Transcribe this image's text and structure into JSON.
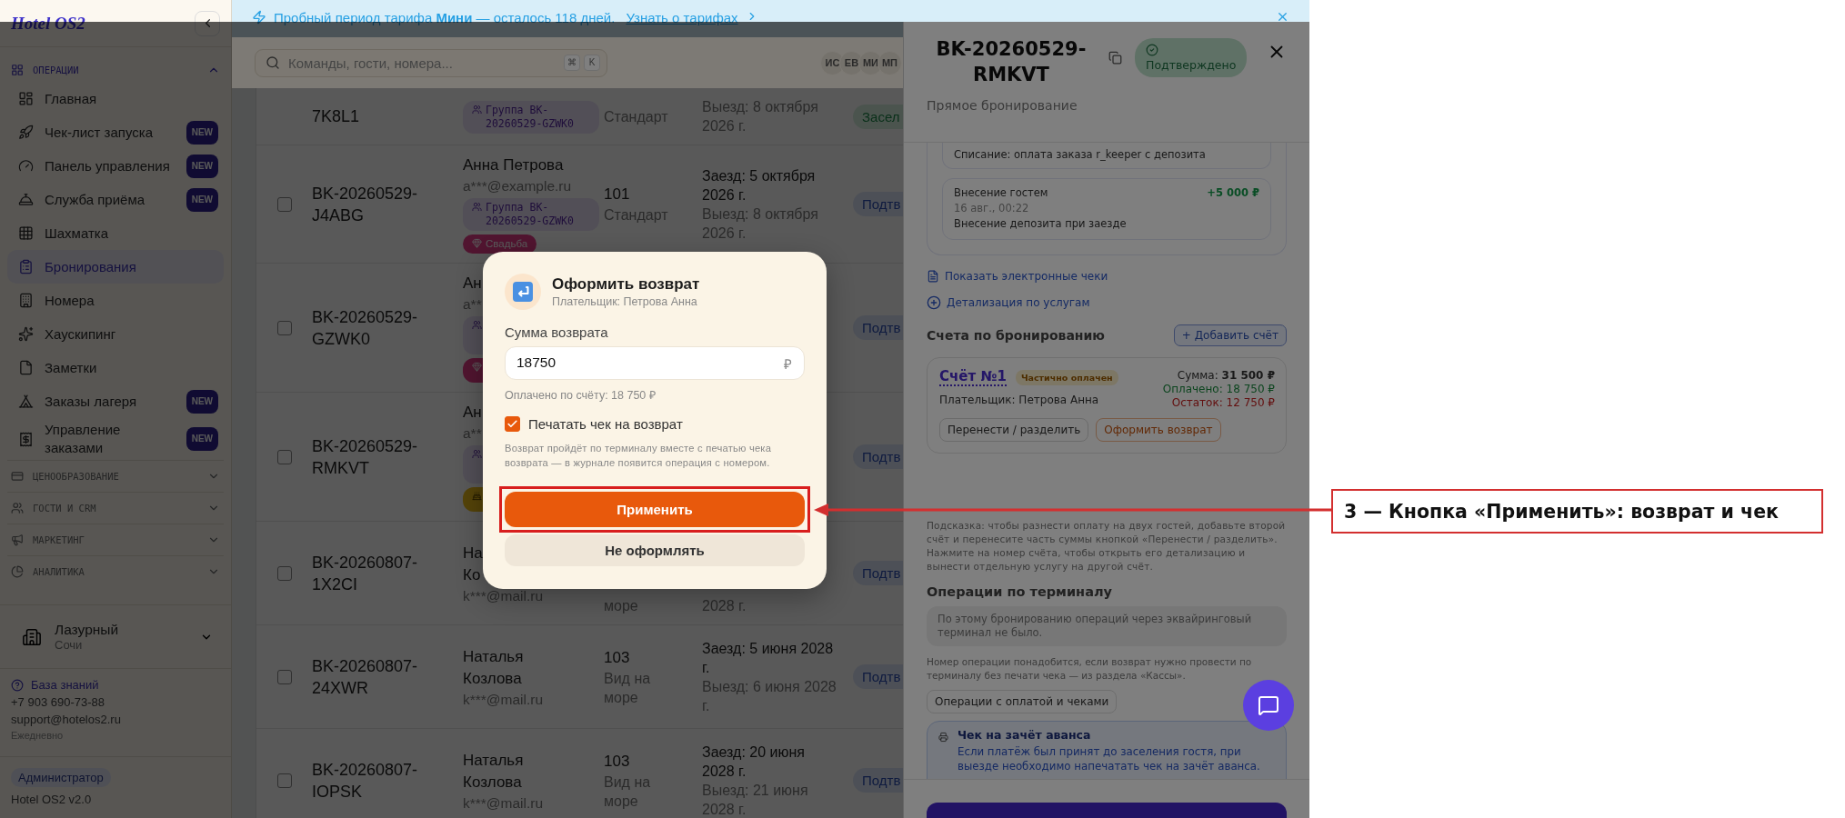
{
  "banner": {
    "text": "Пробный период тарифа **Мини** — осталось 118 дней.",
    "link": "Узнать о тарифах"
  },
  "sidebar": {
    "logo": "Hotel OS2",
    "sections": [
      {
        "title": "ОПЕРАЦИИ",
        "expanded": true,
        "items": [
          {
            "label": "Главная",
            "selected": false
          },
          {
            "label": "Чек-лист запуска",
            "badge": "NEW",
            "selected": false
          },
          {
            "label": "Панель управления",
            "badge": "NEW",
            "selected": false
          },
          {
            "label": "Служба приёма",
            "badge": "NEW",
            "selected": false
          },
          {
            "label": "Шахматка",
            "selected": false
          },
          {
            "label": "Бронирования",
            "selected": true
          },
          {
            "label": "Номера",
            "selected": false
          },
          {
            "label": "Хаускипинг",
            "selected": false
          },
          {
            "label": "Заметки",
            "selected": false
          },
          {
            "label": "Заказы лагеря",
            "badge": "NEW",
            "selected": false
          },
          {
            "label": "Управление заказами",
            "badge": "NEW",
            "selected": false
          }
        ]
      },
      {
        "title": "ЦЕНООБРАЗОВАНИЕ",
        "expanded": false
      },
      {
        "title": "ГОСТИ И CRM",
        "expanded": false
      },
      {
        "title": "МАРКЕТИНГ",
        "expanded": false
      },
      {
        "title": "АНАЛИТИКА",
        "expanded": false
      }
    ],
    "hotel": {
      "name": "Лазурный",
      "city": "Сочи"
    },
    "support": {
      "link": "База знаний",
      "phone": "+7 903 690-73-88",
      "email": "support@hotelos2.ru",
      "hours": "Ежедневно"
    },
    "role": "Администратор",
    "version": "Hotel OS2 v2.0"
  },
  "topbar": {
    "search_placeholder": "Команды, гости, номера...",
    "shortcut": [
      "⌘",
      "K"
    ],
    "avatars": [
      "ИС",
      "ЕВ",
      "МИ",
      "МП"
    ]
  },
  "bookings": [
    {
      "id": "7K8L1",
      "guest": {
        "tags": [
          {
            "kind": "group",
            "label": "Группа BK-20260529-GZWK0"
          }
        ]
      },
      "room": {
        "type": "Стандарт"
      },
      "dates": {
        "checkout": "Выезд: 8 октября 2026 г."
      },
      "status": {
        "kind": "checked_in",
        "label": "Засел"
      }
    },
    {
      "id": "BK-20260529-J4ABG",
      "checked": false,
      "guest": {
        "name": "Анна Петрова",
        "email": "a***@example.ru",
        "tags": [
          {
            "kind": "group",
            "label": "Группа BK-20260529-GZWK0"
          },
          {
            "kind": "wedding",
            "label": "Свадьба"
          }
        ]
      },
      "room": {
        "number": "101",
        "type": "Стандарт"
      },
      "dates": {
        "checkin": "Заезд: 5 октября 2026 г.",
        "checkout": "Выезд: 8 октября 2026 г."
      },
      "status": {
        "kind": "confirmed",
        "label": "Подтв"
      }
    },
    {
      "id": "BK-20260529-GZWK0",
      "checked": false,
      "guest": {
        "name": "Ан",
        "email": "a**",
        "tags": [
          {
            "kind": "group"
          },
          {
            "kind": "wedding"
          }
        ]
      },
      "status": {
        "kind": "confirmed",
        "label": "Подтв"
      }
    },
    {
      "id": "BK-20260529-RMKVT",
      "checked": false,
      "guest": {
        "name": "Ан",
        "email": "a**",
        "tags": [
          {
            "kind": "group"
          },
          {
            "kind": "birthday"
          }
        ]
      },
      "status": {
        "kind": "confirmed",
        "label": "Подтв"
      }
    },
    {
      "id": "BK-20260807-1X2CI",
      "checked": false,
      "covered": true,
      "guest": {
        "name": "На\nКо",
        "email": "k***@mail.ru"
      },
      "room": {
        "type": "море"
      },
      "dates": {
        "checkout": "2028 г."
      },
      "status": {
        "kind": "confirmed",
        "label": "Подтв"
      }
    },
    {
      "id": "BK-20260807-24XWR",
      "checked": false,
      "guest": {
        "name": "Наталья Козлова",
        "email": "k***@mail.ru"
      },
      "room": {
        "number": "103",
        "type": "Вид на море"
      },
      "dates": {
        "checkin": "Заезд: 5 июня 2028 г.",
        "checkout": "Выезд: 6 июня 2028 г."
      },
      "status": {
        "kind": "confirmed",
        "label": "Подтв"
      }
    },
    {
      "id": "BK-20260807-IOPSK",
      "checked": false,
      "guest": {
        "name": "Наталья Козлова",
        "email": "k***@mail.ru"
      },
      "room": {
        "number": "103",
        "type": "Вид на море"
      },
      "dates": {
        "checkin": "Заезд: 20 июня 2028 г.",
        "checkout": "Выезд: 21 июня 2028 г."
      },
      "status": {
        "kind": "confirmed",
        "label": "Подтв"
      }
    }
  ],
  "drawer": {
    "title": "BK-20260529-RMKVT",
    "status": "Подтверждено",
    "source": "Прямое бронирование",
    "deposit_ops": [
      {
        "description": "Списание: оплата заказа r_keeper с депозита"
      },
      {
        "title": "Внесение гостем",
        "amount": "+5 000 ₽",
        "time": "16 авг., 00:22",
        "description": "Внесение депозита при заезде"
      }
    ],
    "links": [
      "Показать электронные чеки",
      "Детализация по услугам"
    ],
    "invoices_title": "Счета по бронированию",
    "add_invoice": "+ Добавить счёт",
    "invoice": {
      "number": "Счёт №1",
      "status": "Частично оплачен",
      "total": "Сумма: **31 500 ₽**",
      "paid": "Оплачено: 18 750 ₽",
      "balance": "Остаток: 12 750 ₽",
      "payer": "Плательщик: Петрова Анна",
      "actions": [
        {
          "label": "Перенести / разделить",
          "kind": "neutral"
        },
        {
          "label": "Оформить возврат",
          "kind": "refund"
        }
      ]
    },
    "hint": "Подсказка: чтобы разнести оплату на двух гостей, добавьте второй счёт и перенесите часть суммы кнопкой «Перенести / разделить». Нажмите на номер счёта, чтобы открыть его детализацию и вынести отдельную услугу на другой счёт.",
    "terminal_title": "Операции по терминалу",
    "terminal_empty": "По этому бронированию операций через эквайринговый терминал не было.",
    "terminal_note": "Номер операции понадобится, если возврат нужно провести по терминалу без печати чека — из раздела «Кассы».",
    "ops_button": "Операции с оплатой и чеками",
    "advance": {
      "title": "Чек на зачёт аванса",
      "text": "Если платёж был принят до заселения гостя, при выезде необходимо напечатать чек на зачёт аванса."
    }
  },
  "modal": {
    "title": "Оформить возврат",
    "payer": "Плательщик: Петрова Анна",
    "amount_label": "Сумма возврата",
    "amount": "18750",
    "currency": "₽",
    "paid_note": "Оплачено по счёту: 18 750 ₽",
    "print_receipt": {
      "label": "Печатать чек на возврат",
      "checked": true
    },
    "note": "Возврат пройдёт по терминалу вместе с печатью чека возврата — в журнале появится операция с номером.",
    "apply": "Применить",
    "cancel": "Не оформлять"
  },
  "annotation": {
    "text": "3 — Кнопка «Применить»: возврат и чек"
  }
}
